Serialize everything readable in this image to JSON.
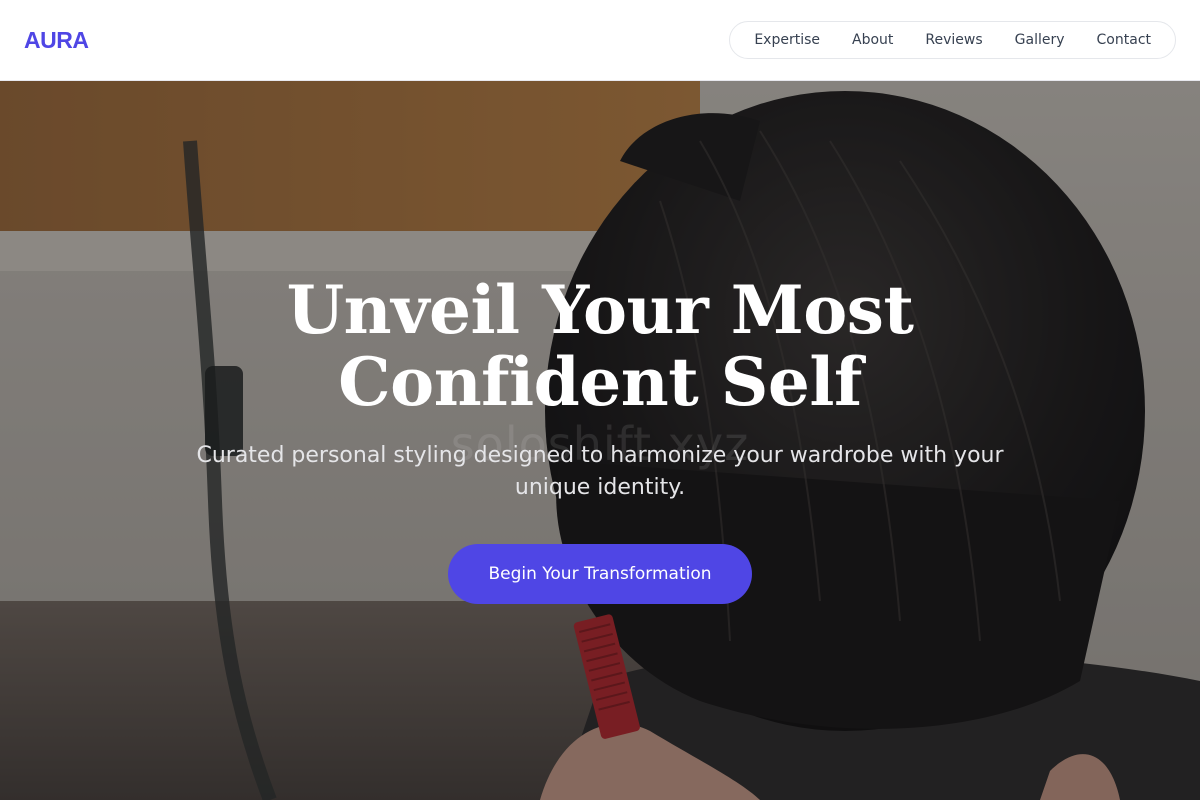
{
  "brand": {
    "logo": "AURA"
  },
  "nav": {
    "items": [
      {
        "label": "Expertise"
      },
      {
        "label": "About"
      },
      {
        "label": "Reviews"
      },
      {
        "label": "Gallery"
      },
      {
        "label": "Contact"
      }
    ]
  },
  "hero": {
    "title": "Unveil Your Most Confident Self",
    "subtitle": "Curated personal styling designed to harmonize your wardrobe with your unique identity.",
    "cta_label": "Begin Your Transformation",
    "watermark": "soloshift.xyz",
    "image_subject": "barber-combing-hair"
  },
  "colors": {
    "accent": "#4f46e5",
    "header_bg": "#ffffff",
    "nav_text": "#374151"
  }
}
